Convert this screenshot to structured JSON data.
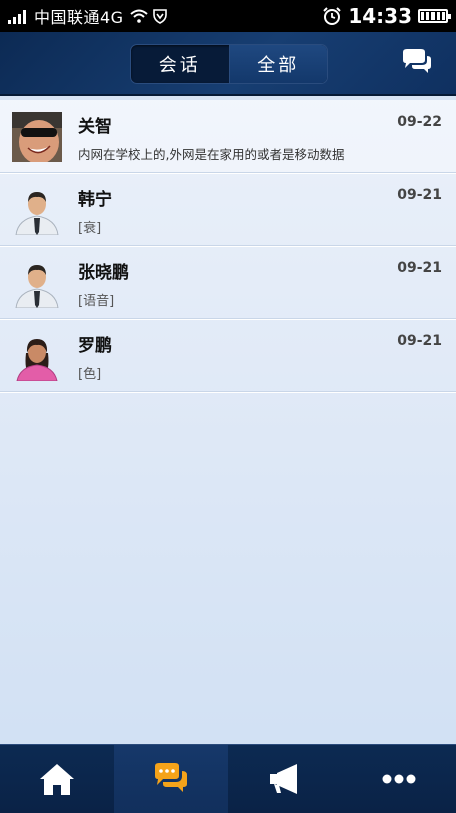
{
  "status_bar": {
    "carrier": "中国联通4G",
    "time": "14:33"
  },
  "header": {
    "tabs": [
      {
        "label": "会话",
        "active": false
      },
      {
        "label": "全部",
        "active": true
      }
    ],
    "chat_icon": "chat-bubbles-icon"
  },
  "conversations": [
    {
      "name": "关智",
      "date": "09-22",
      "message": "内网在学校上的,外网是在家用的或者是移动数据",
      "avatar": "photo"
    },
    {
      "name": "韩宁",
      "date": "09-21",
      "message": "[衰]",
      "avatar": "male"
    },
    {
      "name": "张晓鹏",
      "date": "09-21",
      "message": "[语音]",
      "avatar": "male"
    },
    {
      "name": "罗鹏",
      "date": "09-21",
      "message": "[色]",
      "avatar": "female"
    }
  ],
  "tab_bar": {
    "items": [
      {
        "icon": "home-icon",
        "active": false
      },
      {
        "icon": "chat-icon",
        "active": true
      },
      {
        "icon": "megaphone-icon",
        "active": false
      },
      {
        "icon": "more-icon",
        "active": false
      }
    ],
    "accent": "#f5a31a"
  }
}
